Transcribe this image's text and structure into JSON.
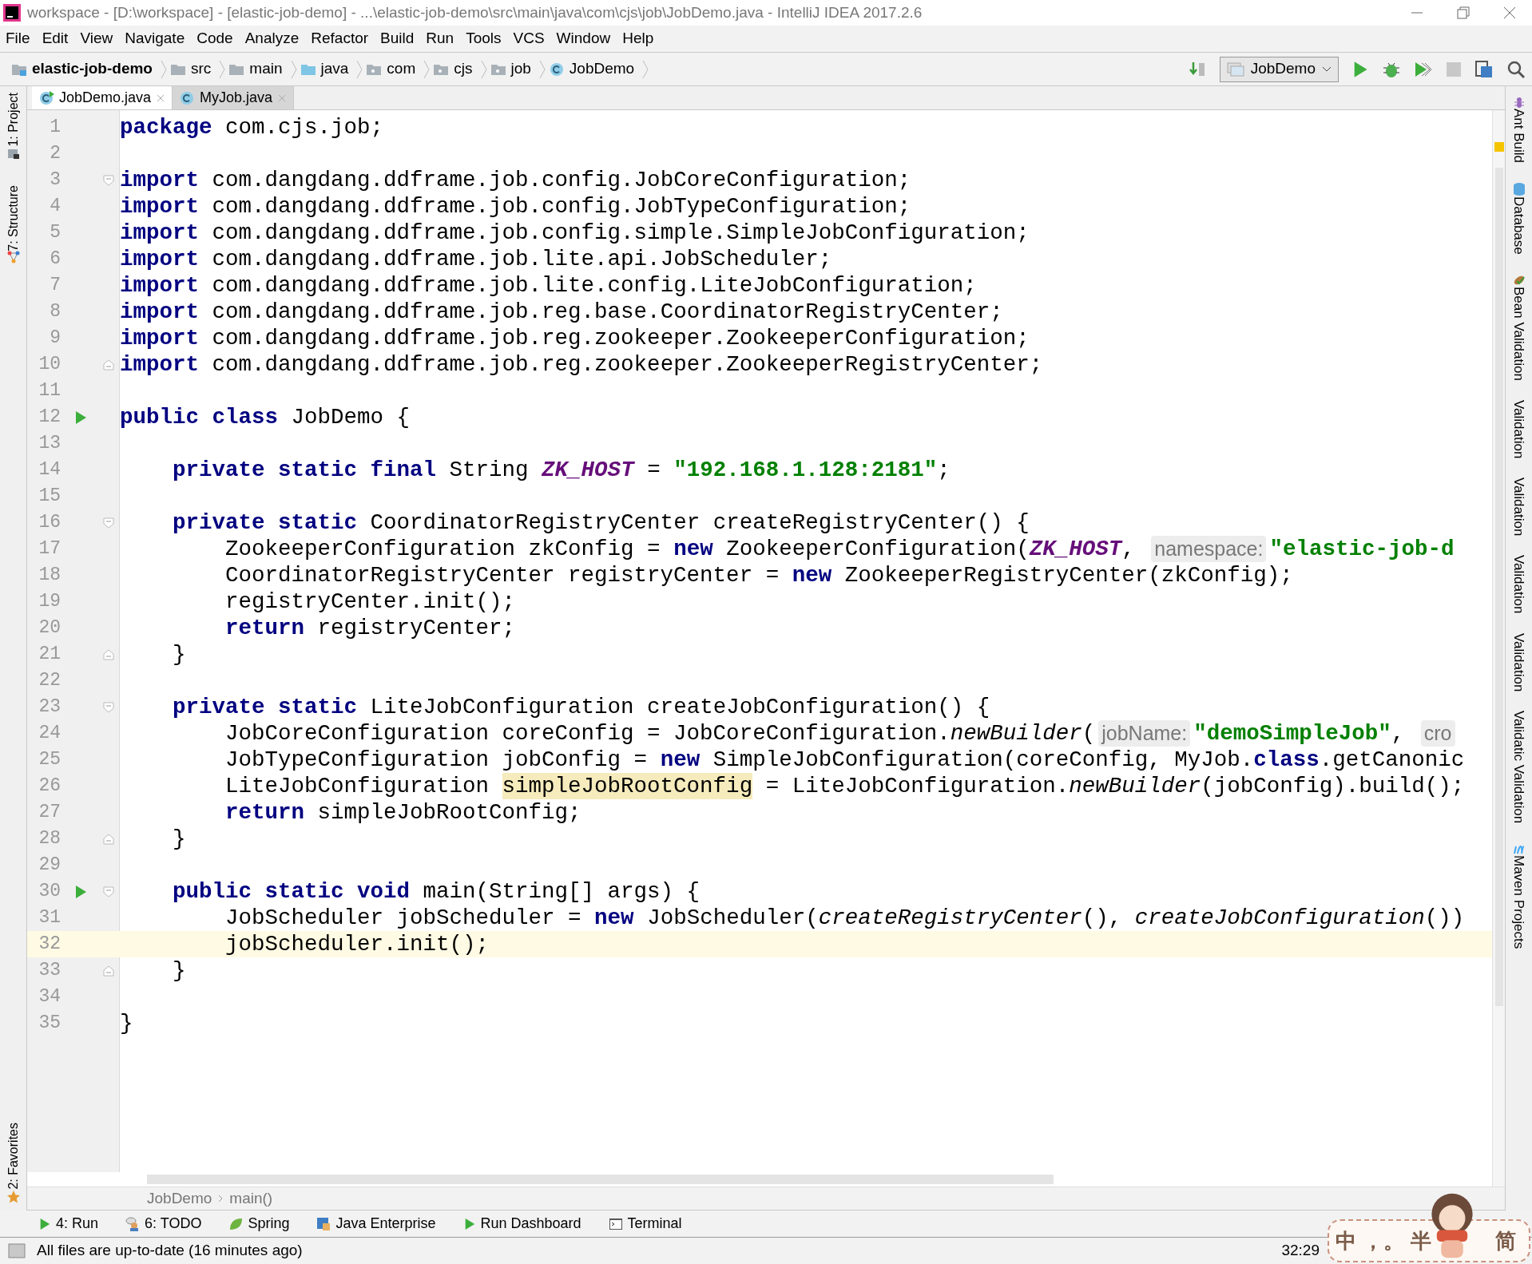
{
  "window": {
    "title": "workspace - [D:\\workspace] - [elastic-job-demo] - ...\\elastic-job-demo\\src\\main\\java\\com\\cjs\\job\\JobDemo.java - IntelliJ IDEA 2017.2.6"
  },
  "menu": [
    "File",
    "Edit",
    "View",
    "Navigate",
    "Code",
    "Analyze",
    "Refactor",
    "Build",
    "Run",
    "Tools",
    "VCS",
    "Window",
    "Help"
  ],
  "navigation": [
    {
      "label": "elastic-job-demo",
      "kind": "project"
    },
    {
      "label": "src",
      "kind": "folder"
    },
    {
      "label": "main",
      "kind": "folder"
    },
    {
      "label": "java",
      "kind": "source"
    },
    {
      "label": "com",
      "kind": "package"
    },
    {
      "label": "cjs",
      "kind": "package"
    },
    {
      "label": "job",
      "kind": "package"
    },
    {
      "label": "JobDemo",
      "kind": "class"
    }
  ],
  "run_configuration": "JobDemo",
  "tabs": [
    {
      "label": "JobDemo.java",
      "selected": true
    },
    {
      "label": "MyJob.java",
      "selected": false
    }
  ],
  "left_tool_windows_top": [
    "1: Project",
    "7: Structure"
  ],
  "left_tool_windows_bottom": [
    "2: Favorites"
  ],
  "right_tool_windows": [
    "Ant Build",
    "Database",
    "Bean Validation",
    "Validation",
    "Validation",
    "Validation",
    "Validation",
    "Validatic Validation",
    "Maven Projects"
  ],
  "editor": {
    "lines": [
      {
        "number": "1",
        "current": false,
        "run": false,
        "fold_start": false,
        "fold_end": false,
        "tokens": [
          {
            "kind": "kw",
            "text": "package"
          },
          {
            "kind": "plain",
            "text": " com.cjs.job;"
          }
        ]
      },
      {
        "number": "2",
        "current": false,
        "run": false,
        "fold_start": false,
        "fold_end": false
      },
      {
        "number": "3",
        "current": false,
        "run": false,
        "fold_start": true,
        "fold_end": false,
        "tokens": [
          {
            "kind": "kw",
            "text": "import"
          },
          {
            "kind": "plain",
            "text": " com.dangdang.ddframe.job.config.JobCoreConfiguration;"
          }
        ]
      },
      {
        "number": "4",
        "current": false,
        "run": false,
        "fold_start": false,
        "fold_end": false,
        "tokens": [
          {
            "kind": "kw",
            "text": "import"
          },
          {
            "kind": "plain",
            "text": " com.dangdang.ddframe.job.config.JobTypeConfiguration;"
          }
        ]
      },
      {
        "number": "5",
        "current": false,
        "run": false,
        "fold_start": false,
        "fold_end": false,
        "tokens": [
          {
            "kind": "kw",
            "text": "import"
          },
          {
            "kind": "plain",
            "text": " com.dangdang.ddframe.job.config.simple.SimpleJobConfiguration;"
          }
        ]
      },
      {
        "number": "6",
        "current": false,
        "run": false,
        "fold_start": false,
        "fold_end": false,
        "tokens": [
          {
            "kind": "kw",
            "text": "import"
          },
          {
            "kind": "plain",
            "text": " com.dangdang.ddframe.job.lite.api.JobScheduler;"
          }
        ]
      },
      {
        "number": "7",
        "current": false,
        "run": false,
        "fold_start": false,
        "fold_end": false,
        "tokens": [
          {
            "kind": "kw",
            "text": "import"
          },
          {
            "kind": "plain",
            "text": " com.dangdang.ddframe.job.lite.config.LiteJobConfiguration;"
          }
        ]
      },
      {
        "number": "8",
        "current": false,
        "run": false,
        "fold_start": false,
        "fold_end": false,
        "tokens": [
          {
            "kind": "kw",
            "text": "import"
          },
          {
            "kind": "plain",
            "text": " com.dangdang.ddframe.job.reg.base.CoordinatorRegistryCenter;"
          }
        ]
      },
      {
        "number": "9",
        "current": false,
        "run": false,
        "fold_start": false,
        "fold_end": false,
        "tokens": [
          {
            "kind": "kw",
            "text": "import"
          },
          {
            "kind": "plain",
            "text": " com.dangdang.ddframe.job.reg.zookeeper.ZookeeperConfiguration;"
          }
        ]
      },
      {
        "number": "10",
        "current": false,
        "run": false,
        "fold_start": false,
        "fold_end": true,
        "tokens": [
          {
            "kind": "kw",
            "text": "import"
          },
          {
            "kind": "plain",
            "text": " com.dangdang.ddframe.job.reg.zookeeper.ZookeeperRegistryCenter;"
          }
        ]
      },
      {
        "number": "11",
        "current": false,
        "run": false,
        "fold_start": false,
        "fold_end": false
      },
      {
        "number": "12",
        "current": false,
        "run": true,
        "fold_start": false,
        "fold_end": false,
        "tokens": [
          {
            "kind": "kw",
            "text": "public class"
          },
          {
            "kind": "plain",
            "text": " JobDemo {"
          }
        ]
      },
      {
        "number": "13",
        "current": false,
        "run": false,
        "fold_start": false,
        "fold_end": false
      },
      {
        "number": "14",
        "current": false,
        "run": false,
        "fold_start": false,
        "fold_end": false,
        "tokens": [
          {
            "kind": "kw",
            "text": "    private static final"
          },
          {
            "kind": "plain",
            "text": " String "
          },
          {
            "kind": "const",
            "text": "ZK_HOST"
          },
          {
            "kind": "plain",
            "text": " = "
          },
          {
            "kind": "str",
            "text": "\"192.168.1.128:2181\""
          },
          {
            "kind": "plain",
            "text": ";"
          }
        ]
      },
      {
        "number": "15",
        "current": false,
        "run": false,
        "fold_start": false,
        "fold_end": false
      },
      {
        "number": "16",
        "current": false,
        "run": false,
        "fold_start": true,
        "fold_end": false,
        "tokens": [
          {
            "kind": "kw",
            "text": "    private static"
          },
          {
            "kind": "plain",
            "text": " CoordinatorRegistryCenter createRegistryCenter() {"
          }
        ]
      },
      {
        "number": "17",
        "current": false,
        "run": false,
        "fold_start": false,
        "fold_end": false,
        "tokens": [
          {
            "kind": "plain",
            "text": "        ZookeeperConfiguration zkConfig = "
          },
          {
            "kind": "kw",
            "text": "new"
          },
          {
            "kind": "plain",
            "text": " ZookeeperConfiguration("
          },
          {
            "kind": "const",
            "text": "ZK_HOST"
          },
          {
            "kind": "plain",
            "text": ", "
          },
          {
            "kind": "hint",
            "text": "namespace:"
          },
          {
            "kind": "str",
            "text": "\"elastic-job-d"
          }
        ]
      },
      {
        "number": "18",
        "current": false,
        "run": false,
        "fold_start": false,
        "fold_end": false,
        "tokens": [
          {
            "kind": "plain",
            "text": "        CoordinatorRegistryCenter registryCenter = "
          },
          {
            "kind": "kw",
            "text": "new"
          },
          {
            "kind": "plain",
            "text": " ZookeeperRegistryCenter(zkConfig);"
          }
        ]
      },
      {
        "number": "19",
        "current": false,
        "run": false,
        "fold_start": false,
        "fold_end": false,
        "tokens": [
          {
            "kind": "plain",
            "text": "        registryCenter.init();"
          }
        ]
      },
      {
        "number": "20",
        "current": false,
        "run": false,
        "fold_start": false,
        "fold_end": false,
        "tokens": [
          {
            "kind": "kw",
            "text": "        return"
          },
          {
            "kind": "plain",
            "text": " registryCenter;"
          }
        ]
      },
      {
        "number": "21",
        "current": false,
        "run": false,
        "fold_start": false,
        "fold_end": true,
        "tokens": [
          {
            "kind": "plain",
            "text": "    }"
          }
        ]
      },
      {
        "number": "22",
        "current": false,
        "run": false,
        "fold_start": false,
        "fold_end": false
      },
      {
        "number": "23",
        "current": false,
        "run": false,
        "fold_start": true,
        "fold_end": false,
        "tokens": [
          {
            "kind": "kw",
            "text": "    private static"
          },
          {
            "kind": "plain",
            "text": " LiteJobConfiguration createJobConfiguration() {"
          }
        ]
      },
      {
        "number": "24",
        "current": false,
        "run": false,
        "fold_start": false,
        "fold_end": false,
        "tokens": [
          {
            "kind": "plain",
            "text": "        JobCoreConfiguration coreConfig = JobCoreConfiguration."
          },
          {
            "kind": "italic",
            "text": "newBuilder"
          },
          {
            "kind": "plain",
            "text": "("
          },
          {
            "kind": "hint",
            "text": "jobName:"
          },
          {
            "kind": "str",
            "text": "\"demoSimpleJob\""
          },
          {
            "kind": "plain",
            "text": ", "
          },
          {
            "kind": "hint",
            "text": "cro"
          }
        ]
      },
      {
        "number": "25",
        "current": false,
        "run": false,
        "fold_start": false,
        "fold_end": false,
        "tokens": [
          {
            "kind": "plain",
            "text": "        JobTypeConfiguration jobConfig = "
          },
          {
            "kind": "kw",
            "text": "new"
          },
          {
            "kind": "plain",
            "text": " SimpleJobConfiguration(coreConfig, MyJob."
          },
          {
            "kind": "kw",
            "text": "class"
          },
          {
            "kind": "plain",
            "text": ".getCanonic"
          }
        ]
      },
      {
        "number": "26",
        "current": false,
        "run": false,
        "fold_start": false,
        "fold_end": false,
        "tokens": [
          {
            "kind": "plain",
            "text": "        LiteJobConfiguration "
          },
          {
            "kind": "hl",
            "text": "simpleJobRootConfig"
          },
          {
            "kind": "plain",
            "text": " = LiteJobConfiguration."
          },
          {
            "kind": "italic",
            "text": "newBuilder"
          },
          {
            "kind": "plain",
            "text": "(jobConfig).build();"
          }
        ]
      },
      {
        "number": "27",
        "current": false,
        "run": false,
        "fold_start": false,
        "fold_end": false,
        "tokens": [
          {
            "kind": "kw",
            "text": "        return"
          },
          {
            "kind": "plain",
            "text": " simpleJobRootConfig;"
          }
        ]
      },
      {
        "number": "28",
        "current": false,
        "run": false,
        "fold_start": false,
        "fold_end": true,
        "tokens": [
          {
            "kind": "plain",
            "text": "    }"
          }
        ]
      },
      {
        "number": "29",
        "current": false,
        "run": false,
        "fold_start": false,
        "fold_end": false
      },
      {
        "number": "30",
        "current": false,
        "run": true,
        "fold_start": true,
        "fold_end": false,
        "tokens": [
          {
            "kind": "kw",
            "text": "    public static void"
          },
          {
            "kind": "plain",
            "text": " main(String[] args) {"
          }
        ]
      },
      {
        "number": "31",
        "current": false,
        "run": false,
        "fold_start": false,
        "fold_end": false,
        "tokens": [
          {
            "kind": "plain",
            "text": "        JobScheduler jobScheduler = "
          },
          {
            "kind": "kw",
            "text": "new"
          },
          {
            "kind": "plain",
            "text": " JobScheduler("
          },
          {
            "kind": "italic",
            "text": "createRegistryCenter"
          },
          {
            "kind": "plain",
            "text": "(), "
          },
          {
            "kind": "italic",
            "text": "createJobConfiguration"
          },
          {
            "kind": "plain",
            "text": "())"
          }
        ]
      },
      {
        "number": "32",
        "current": true,
        "run": false,
        "fold_start": false,
        "fold_end": false,
        "tokens": [
          {
            "kind": "plain",
            "text": "        jobScheduler.init();"
          }
        ]
      },
      {
        "number": "33",
        "current": false,
        "run": false,
        "fold_start": false,
        "fold_end": true,
        "tokens": [
          {
            "kind": "plain",
            "text": "    }"
          }
        ]
      },
      {
        "number": "34",
        "current": false,
        "run": false,
        "fold_start": false,
        "fold_end": false
      },
      {
        "number": "35",
        "current": false,
        "run": false,
        "fold_start": false,
        "fold_end": false,
        "tokens": [
          {
            "kind": "plain",
            "text": "}"
          }
        ]
      }
    ]
  },
  "breadcrumbs": [
    "JobDemo",
    "main()"
  ],
  "tool_windows": [
    {
      "label": "4: Run",
      "kind": "run"
    },
    {
      "label": "6: TODO",
      "kind": "todo"
    },
    {
      "label": "Spring",
      "kind": "spring"
    },
    {
      "label": "Java Enterprise",
      "kind": "javaee"
    },
    {
      "label": "Run Dashboard",
      "kind": "run"
    },
    {
      "label": "Terminal",
      "kind": "terminal"
    }
  ],
  "status_bar": {
    "message": "All files are up-to-date (16 minutes ago)",
    "position": "32:29"
  },
  "input_method": {
    "items": [
      "中",
      "，。",
      "半",
      "简"
    ]
  }
}
